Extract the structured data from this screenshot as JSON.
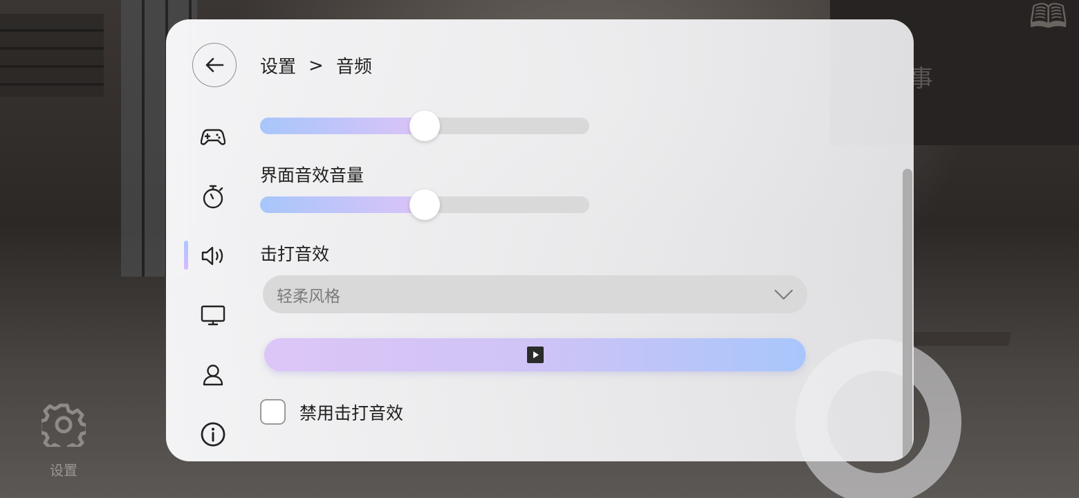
{
  "breadcrumb": {
    "root": "设置",
    "separator": ">",
    "current": "音频"
  },
  "nav": {
    "items": [
      {
        "name": "game",
        "icon": "gamepad-icon"
      },
      {
        "name": "timer",
        "icon": "stopwatch-icon"
      },
      {
        "name": "audio",
        "icon": "speaker-icon",
        "active": true
      },
      {
        "name": "display",
        "icon": "monitor-icon"
      },
      {
        "name": "account",
        "icon": "user-icon"
      },
      {
        "name": "about",
        "icon": "info-icon"
      }
    ]
  },
  "audio": {
    "top_slider": {
      "value": 0.5
    },
    "ui_sound": {
      "label": "界面音效音量",
      "value": 0.5
    },
    "hit_sound": {
      "label": "击打音效",
      "selected": "轻柔风格"
    },
    "disable_hit_sound": {
      "label": "禁用击打音效",
      "checked": false
    }
  },
  "background": {
    "board_text": "事"
  },
  "bottom": {
    "settings_label": "设置"
  },
  "colors": {
    "accent_blue": "#a7c6fb",
    "accent_purple": "#dcc3f7",
    "track": "#d9d9d9"
  }
}
